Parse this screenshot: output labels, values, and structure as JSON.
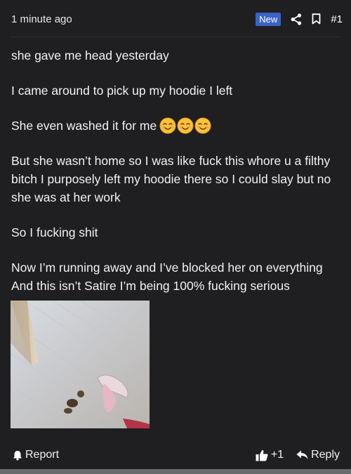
{
  "header": {
    "time": "1 minute ago",
    "badge": "New",
    "post_number": "#1"
  },
  "body": {
    "lines": [
      "she gave me head yesterday",
      "I came around to pick up my hoodie I left",
      "She even washed it for me",
      "But she wasn’t home so I was like fuck this whore u a filthy bitch I purposely left my hoodie there so I could slay but no she was at her work",
      "So I fucking shit",
      "Now I’m running away and I’ve blocked her on everything",
      "And this isn’t Satire I’m being 100% fucking serious"
    ],
    "emojis": [
      "smiling-face-emoji",
      "smiling-face-emoji",
      "smiling-face-emoji"
    ]
  },
  "footer": {
    "report_label": "Report",
    "like_count": "+1",
    "reply_label": "Reply"
  },
  "icons": {
    "share": "share-icon",
    "bookmark": "bookmark-icon",
    "report": "bell-icon",
    "like": "thumbs-up-icon",
    "reply": "reply-arrow-icon"
  },
  "colors": {
    "background": "#1f1f22",
    "badge": "#3a63c8",
    "text": "#f2f2f2"
  }
}
